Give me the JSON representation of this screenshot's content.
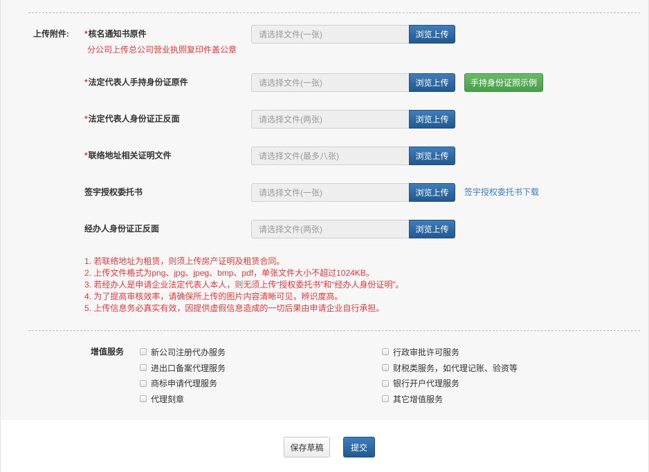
{
  "upload": {
    "section_label": "上传附件:",
    "required_mark": "*",
    "browse_label": "浏览上传",
    "items": [
      {
        "label": "核名通知书原件",
        "placeholder": "请选择文件(一张)",
        "note": "分公司上传总公司营业执照复印件盖公章"
      },
      {
        "label": "法定代表人手持身份证原件",
        "placeholder": "请选择文件(一张)",
        "extra_button": "手持身份证照示例"
      },
      {
        "label": "法定代表人身份证正反面",
        "placeholder": "请选择文件(两张)"
      },
      {
        "label": "联络地址相关证明文件",
        "placeholder": "请选择文件(最多八张)"
      },
      {
        "label": "签宇授权委托书",
        "placeholder": "请选择文件(一张)",
        "extra_link": "签宇授权委托书下载"
      },
      {
        "label": "经办人身份证正反面",
        "placeholder": "请选择文件(两张)"
      }
    ],
    "notes": [
      "1. 若联络地址为租赁，则须上传房产证明及租赁合同。",
      "2. 上传文件格式为png、jpg、jpeg、bmp、pdf，单张文件大小不超过1024KB。",
      "3. 若经办人是申请企业法定代表人本人，则无须上传“授权委托书”和“经办人身份证明”。",
      "4. 为了提高审核效率，请确保所上传的图片内容清晰可见，辨识度高。",
      "5. 上传信息务必真实有效，因提供虚假信息造成的一切后果由申请企业自行承担。"
    ]
  },
  "services": {
    "label": "增值服务",
    "left": [
      "新公司注册代办服务",
      "进出口备案代理服务",
      "商标申请代理服务",
      "代理刻章"
    ],
    "right": [
      "行政审批许可服务",
      "财税类服务，如代理记账、验资等",
      "银行开户代理服务",
      "其它增值服务"
    ]
  },
  "actions": {
    "save_draft": "保存草稿",
    "submit": "提交"
  },
  "colors": {
    "accent": "#22598f",
    "green": "#489f48",
    "required": "#e4393c",
    "link": "#3b7dc4",
    "panel_bg": "#f7f7f7"
  }
}
